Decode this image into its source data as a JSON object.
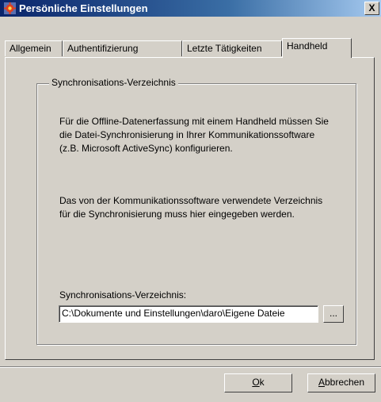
{
  "window": {
    "title": "Persönliche Einstellungen",
    "close_glyph": "X"
  },
  "tabs": [
    {
      "label": "Allgemein"
    },
    {
      "label": "Authentifizierung"
    },
    {
      "label": "Letzte Tätigkeiten"
    },
    {
      "label": "Handheld",
      "active": true
    }
  ],
  "group": {
    "title": "Synchronisations-Verzeichnis",
    "para1": "Für die Offline-Datenerfassung mit einem Handheld müssen Sie die Datei-Synchronisierung in Ihrer Kommunikationssoftware (z.B. Microsoft ActiveSync) konfigurieren.",
    "para2": "Das von der Kommunikationssoftware verwendete Verzeichnis für die Synchronisierung muss hier eingegeben werden.",
    "field_label": "Synchronisations-Verzeichnis:",
    "path_value": "C:\\Dokumente und Einstellungen\\daro\\Eigene Dateie",
    "browse_label": "..."
  },
  "buttons": {
    "ok_mnemonic": "O",
    "ok_rest": "k",
    "cancel_mnemonic": "A",
    "cancel_rest": "bbrechen"
  }
}
